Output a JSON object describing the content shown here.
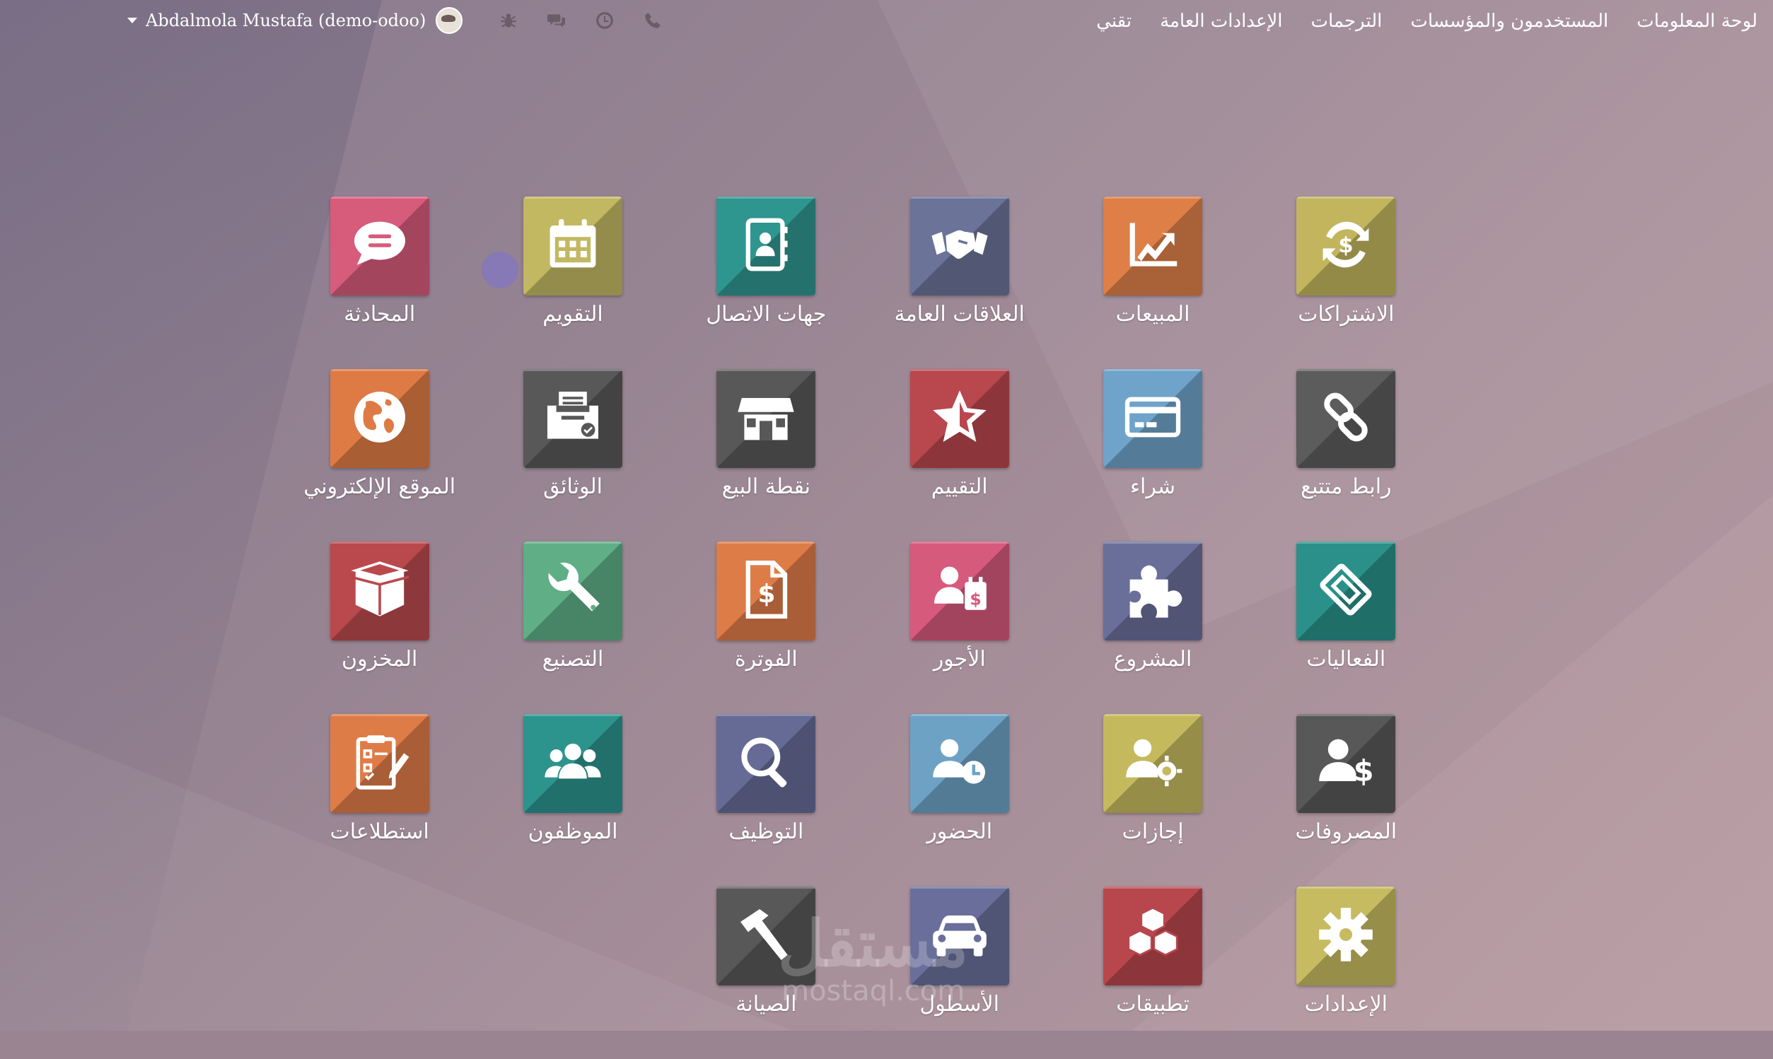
{
  "topbar": {
    "menu": [
      "لوحة المعلومات",
      "المستخدمون والمؤسسات",
      "الترجمات",
      "الإعدادات العامة",
      "تقني"
    ],
    "user_name": "Abdalmola Mustafa (demo-odoo)",
    "tray_icons": [
      "phone-icon",
      "clock-icon",
      "chat-icon",
      "bug-icon"
    ]
  },
  "apps": [
    {
      "label": "الاشتراكات",
      "icon": "subscription-icon",
      "color": "#c2b55e"
    },
    {
      "label": "المبيعات",
      "icon": "sales-icon",
      "color": "#de7f48"
    },
    {
      "label": "العلاقات العامة",
      "icon": "handshake-icon",
      "color": "#6b7398"
    },
    {
      "label": "جهات الاتصال",
      "icon": "contacts-icon",
      "color": "#2f958f"
    },
    {
      "label": "التقويم",
      "icon": "calendar-icon",
      "color": "#c3b862"
    },
    {
      "label": "المحادثة",
      "icon": "chat-bubble-icon",
      "color": "#d75b7b"
    },
    {
      "label": "رابط متتبع",
      "icon": "link-icon",
      "color": "#5c5c5c"
    },
    {
      "label": "شراء",
      "icon": "credit-card-icon",
      "color": "#6fa3c9"
    },
    {
      "label": "التقييم",
      "icon": "star-icon",
      "color": "#b8474e"
    },
    {
      "label": "نقطة البيع",
      "icon": "store-icon",
      "color": "#585858"
    },
    {
      "label": "الوثائق",
      "icon": "documents-icon",
      "color": "#585858"
    },
    {
      "label": "الموقع الإلكتروني",
      "icon": "globe-icon",
      "color": "#de7b45"
    },
    {
      "label": "الفعاليات",
      "icon": "ticket-icon",
      "color": "#2a9089"
    },
    {
      "label": "المشروع",
      "icon": "puzzle-icon",
      "color": "#6a6f9a"
    },
    {
      "label": "الأجور",
      "icon": "payroll-icon",
      "color": "#d65a7c"
    },
    {
      "label": "الفوترة",
      "icon": "invoice-icon",
      "color": "#de7c48"
    },
    {
      "label": "التصنيع",
      "icon": "wrench-icon",
      "color": "#5fae86"
    },
    {
      "label": "المخزون",
      "icon": "box-icon",
      "color": "#b9494d"
    },
    {
      "label": "المصروفات",
      "icon": "expense-icon",
      "color": "#585858"
    },
    {
      "label": "إجازات",
      "icon": "leaves-icon",
      "color": "#c5b95e"
    },
    {
      "label": "الحضور",
      "icon": "attendance-icon",
      "color": "#6da2c5"
    },
    {
      "label": "التوظيف",
      "icon": "search-icon",
      "color": "#666b96"
    },
    {
      "label": "الموظفون",
      "icon": "employees-icon",
      "color": "#2d938d"
    },
    {
      "label": "استطلاعات",
      "icon": "survey-icon",
      "color": "#de7c48"
    },
    {
      "label": "الإعدادات",
      "icon": "gear-icon",
      "color": "#c6bb60"
    },
    {
      "label": "تطبيقات",
      "icon": "cubes-icon",
      "color": "#b8474d"
    },
    {
      "label": "الأسطول",
      "icon": "car-icon",
      "color": "#696f9a"
    },
    {
      "label": "الصيانة",
      "icon": "hammer-icon",
      "color": "#585858"
    }
  ],
  "watermark": {
    "arabic": "مستقل",
    "latin": "mostaql.com"
  }
}
